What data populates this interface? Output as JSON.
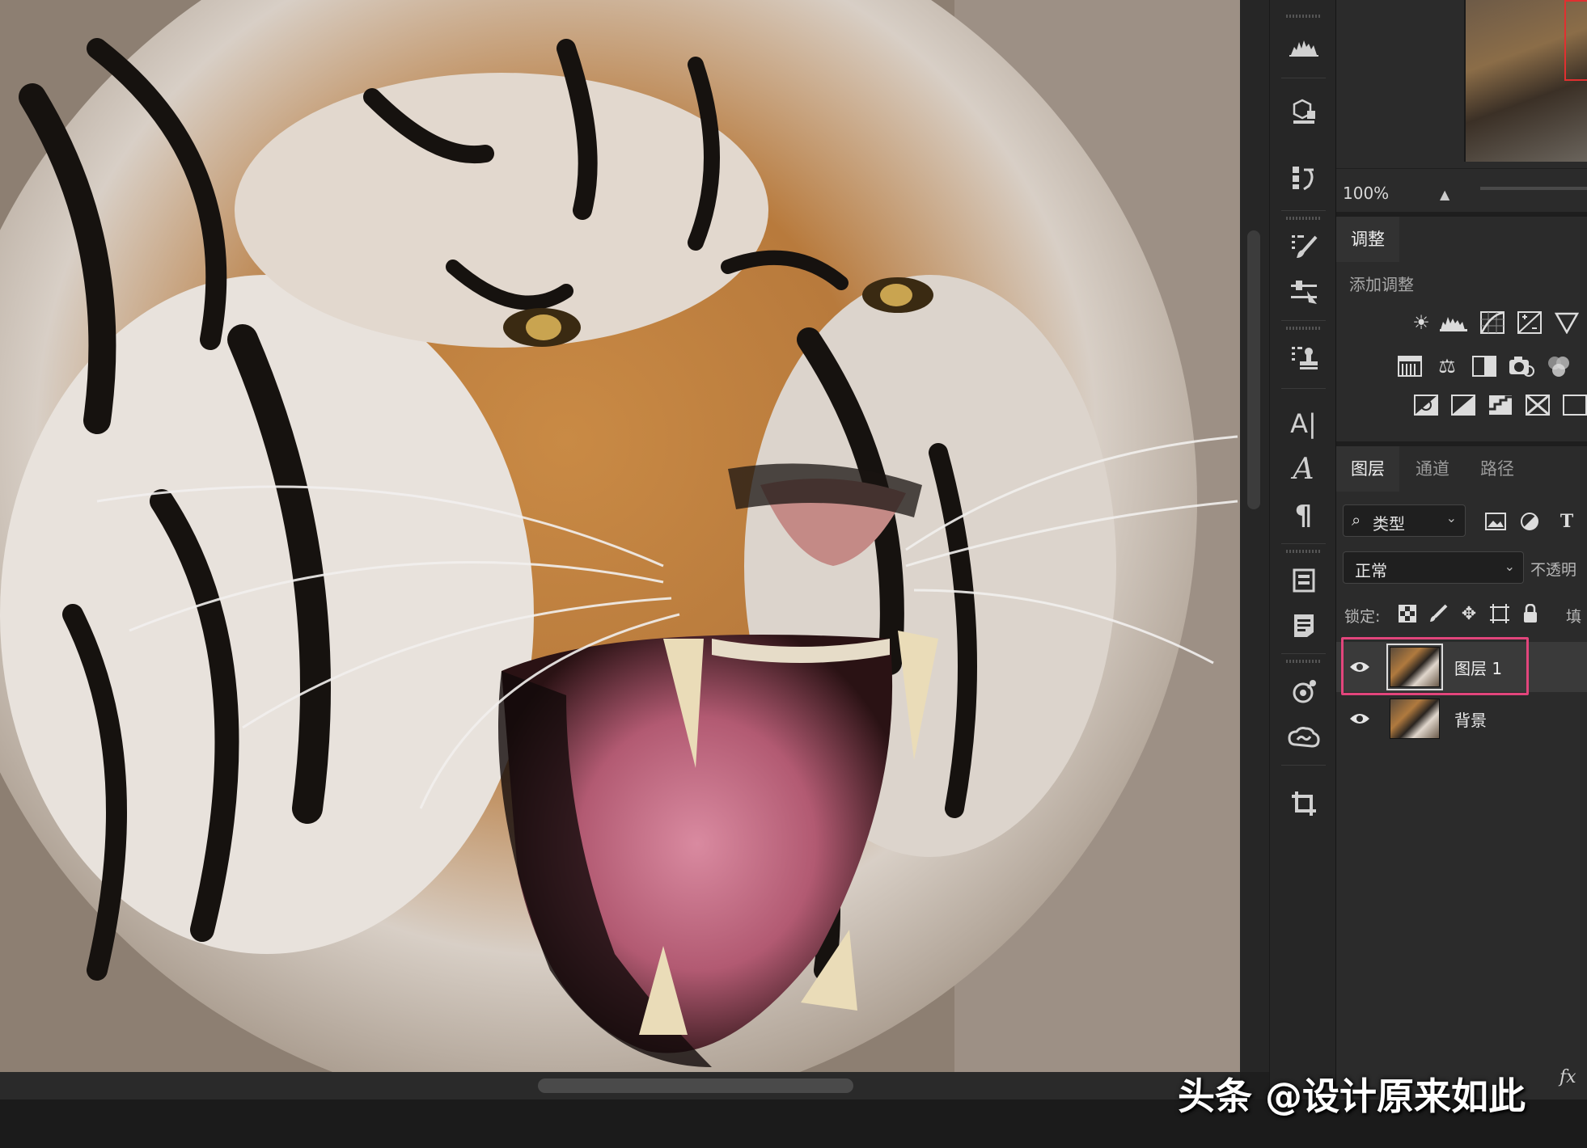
{
  "navigator": {
    "zoom": "100%"
  },
  "adjustments": {
    "tab_label": "调整",
    "add_label": "添加调整",
    "row1": [
      "brightness-contrast-icon",
      "levels-icon",
      "curves-icon",
      "exposure-icon",
      "vibrance-icon"
    ],
    "row2": [
      "hue-saturation-icon",
      "color-balance-icon",
      "black-white-icon",
      "photo-filter-icon",
      "channel-mixer-icon"
    ],
    "row3": [
      "invert-icon",
      "posterize-icon",
      "threshold-icon",
      "selective-color-icon",
      "gradient-map-icon"
    ]
  },
  "layers_panel": {
    "tabs": [
      {
        "label": "图层",
        "active": true
      },
      {
        "label": "通道",
        "active": false
      },
      {
        "label": "路径",
        "active": false
      }
    ],
    "filter_label": "类型",
    "blend_mode": "正常",
    "opacity_label": "不透明",
    "lock_label": "锁定:",
    "fill_label": "填",
    "layers": [
      {
        "name": "图层 1",
        "visible": true,
        "selected": true
      },
      {
        "name": "背景",
        "visible": true,
        "selected": false
      }
    ],
    "fx_label": "fx"
  },
  "watermark": "头条 @设计原来如此",
  "colors": {
    "highlight": "#e2457c",
    "panel_bg": "#2b2b2b",
    "toolstrip_bg": "#262626"
  }
}
